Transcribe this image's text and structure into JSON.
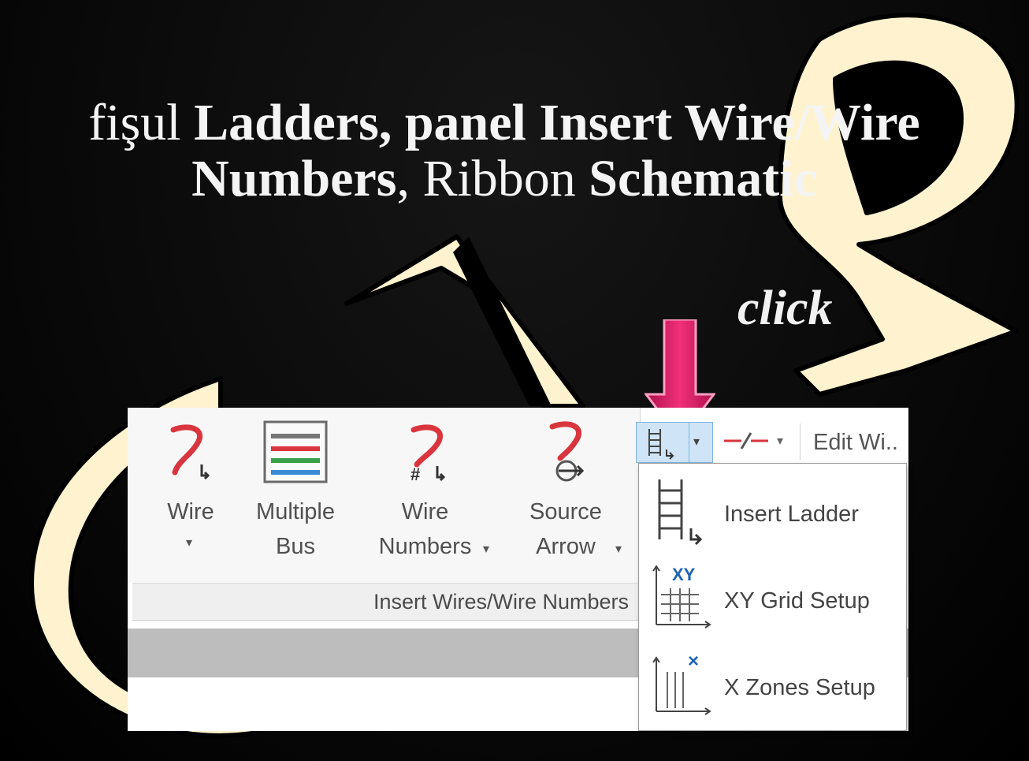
{
  "heading": {
    "line1_prefix": "fişul",
    "line1_bold": "Ladders, panel Insert Wire/Wire",
    "line2_bold_a": "Numbers",
    "line2_sep": ", Ribbon",
    "line2_bold_b": "Schematic"
  },
  "annotation": {
    "click_label": "click"
  },
  "ribbon": {
    "tools": [
      {
        "label1": "Wire",
        "label2": "",
        "has_dropdown": true
      },
      {
        "label1": "Multiple",
        "label2": "Bus",
        "has_dropdown": false
      },
      {
        "label1": "Wire",
        "label2": "Numbers",
        "has_dropdown": true
      },
      {
        "label1": "Source",
        "label2": "Arrow",
        "has_dropdown": true
      }
    ],
    "panel_title": "Insert Wires/Wire Numbers",
    "edit_wire_label": "Edit Wi..",
    "ladder_menu": [
      {
        "label": "Insert Ladder",
        "icon": "insert-ladder-icon"
      },
      {
        "label": "XY Grid Setup",
        "icon": "xy-grid-icon"
      },
      {
        "label": "X Zones Setup",
        "icon": "x-zones-icon"
      }
    ]
  },
  "colors": {
    "background": "#000000",
    "decor_cream": "#fff3cf",
    "wire_red": "#d9353e",
    "click_arrow": "#e8246f",
    "highlight_blue": "#cfe4f7"
  }
}
